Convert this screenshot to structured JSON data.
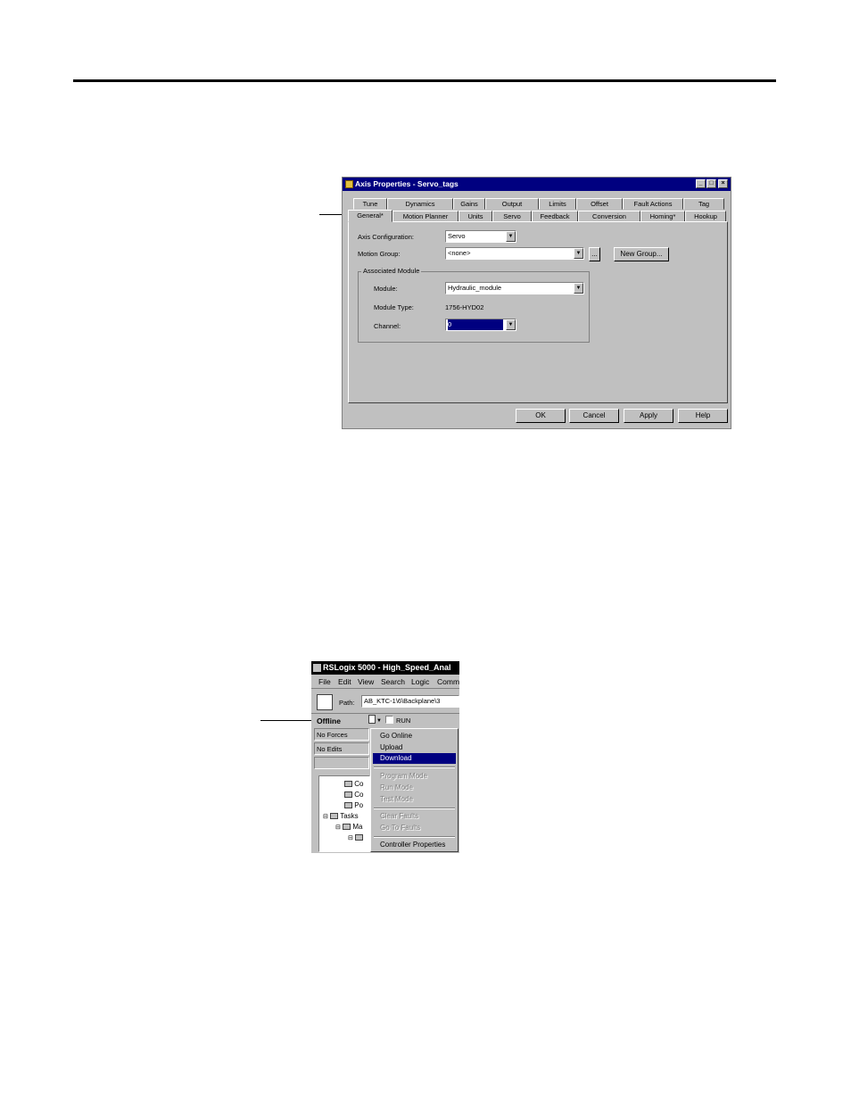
{
  "dialog": {
    "title": "Axis Properties - Servo_tags",
    "window_buttons": [
      "_",
      "□",
      "×"
    ],
    "tabs_back": [
      "Tune",
      "Dynamics",
      "Gains",
      "Output",
      "Limits",
      "Offset",
      "Fault Actions",
      "Tag"
    ],
    "tabs_front": [
      "General*",
      "Motion Planner",
      "Units",
      "Servo",
      "Feedback",
      "Conversion",
      "Homing*",
      "Hookup"
    ],
    "axis_configuration_label": "Axis Configuration:",
    "axis_configuration_value": "Servo",
    "motion_group_label": "Motion Group:",
    "motion_group_value": "<none>",
    "ellipsis_button": "...",
    "new_group_button": "New Group...",
    "associated_module_caption": "Associated Module",
    "module_label": "Module:",
    "module_value": "Hydraulic_module",
    "module_type_label": "Module Type:",
    "module_type_value": "1756-HYD02",
    "channel_label": "Channel:",
    "channel_value": "0",
    "ok_button": "OK",
    "cancel_button": "Cancel",
    "apply_button": "Apply",
    "help_button": "Help"
  },
  "rslogix": {
    "title": "RSLogix 5000 - High_Speed_Anal",
    "menu": [
      "File",
      "Edit",
      "View",
      "Search",
      "Logic",
      "Comm"
    ],
    "path_label": "Path:",
    "path_value": "AB_KTC-1\\6\\Backplane\\3",
    "status_offline": "Offline",
    "run_label": "RUN",
    "no_forces": "No Forces",
    "no_edits": "No Edits",
    "dropdown_menu": {
      "go_online": "Go Online",
      "upload": "Upload",
      "download": "Download",
      "program_mode": "Program Mode",
      "run_mode": "Run Mode",
      "test_mode": "Test Mode",
      "clear_faults": "Clear Faults",
      "go_to_faults": "Go To Faults",
      "controller_properties": "Controller Properties"
    },
    "tree": [
      "Co",
      "Co",
      "Po",
      "Tasks",
      "Ma",
      ""
    ]
  },
  "colors": {
    "titlebar": "#000080",
    "face": "#c0c0c0",
    "selected": "#000080"
  }
}
